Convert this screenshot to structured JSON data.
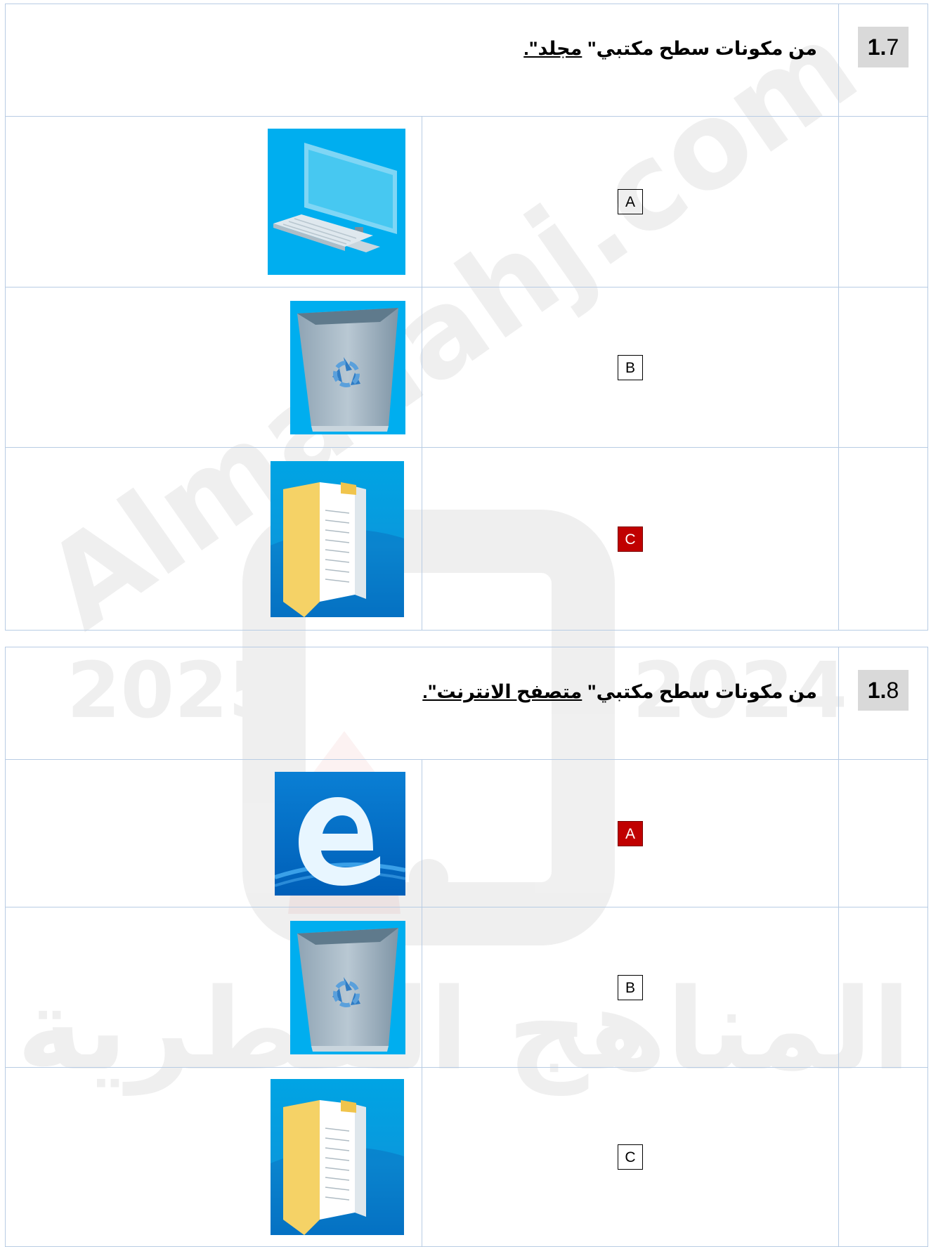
{
  "watermark": {
    "site": "Almanahj.com",
    "years_left": "2025",
    "years_right": "2024",
    "arabic_name": "المناهج القطرية"
  },
  "questions": [
    {
      "number_bold": "1.",
      "number_rest": "7",
      "text_prefix": "من مكونات سطح مكتبي\"",
      "text_target": "مجلد\".",
      "options": [
        {
          "letter": "A",
          "icon": "this-pc-icon",
          "correct": false
        },
        {
          "letter": "B",
          "icon": "recycle-bin-icon",
          "correct": false
        },
        {
          "letter": "C",
          "icon": "file-explorer-folder-icon",
          "correct": true
        }
      ]
    },
    {
      "number_bold": "1.",
      "number_rest": "8",
      "text_prefix": "من مكونات سطح مكتبي\"",
      "text_target": "متصفح الانترنت\".",
      "options": [
        {
          "letter": "A",
          "icon": "edge-browser-icon",
          "correct": true
        },
        {
          "letter": "B",
          "icon": "recycle-bin-icon",
          "correct": false
        },
        {
          "letter": "C",
          "icon": "file-explorer-folder-icon",
          "correct": false
        }
      ]
    }
  ],
  "colors": {
    "border": "#b8cce4",
    "number_bg": "#d9d9d9",
    "correct_bg": "#c00000",
    "icon_blue": "#00a4e4"
  }
}
